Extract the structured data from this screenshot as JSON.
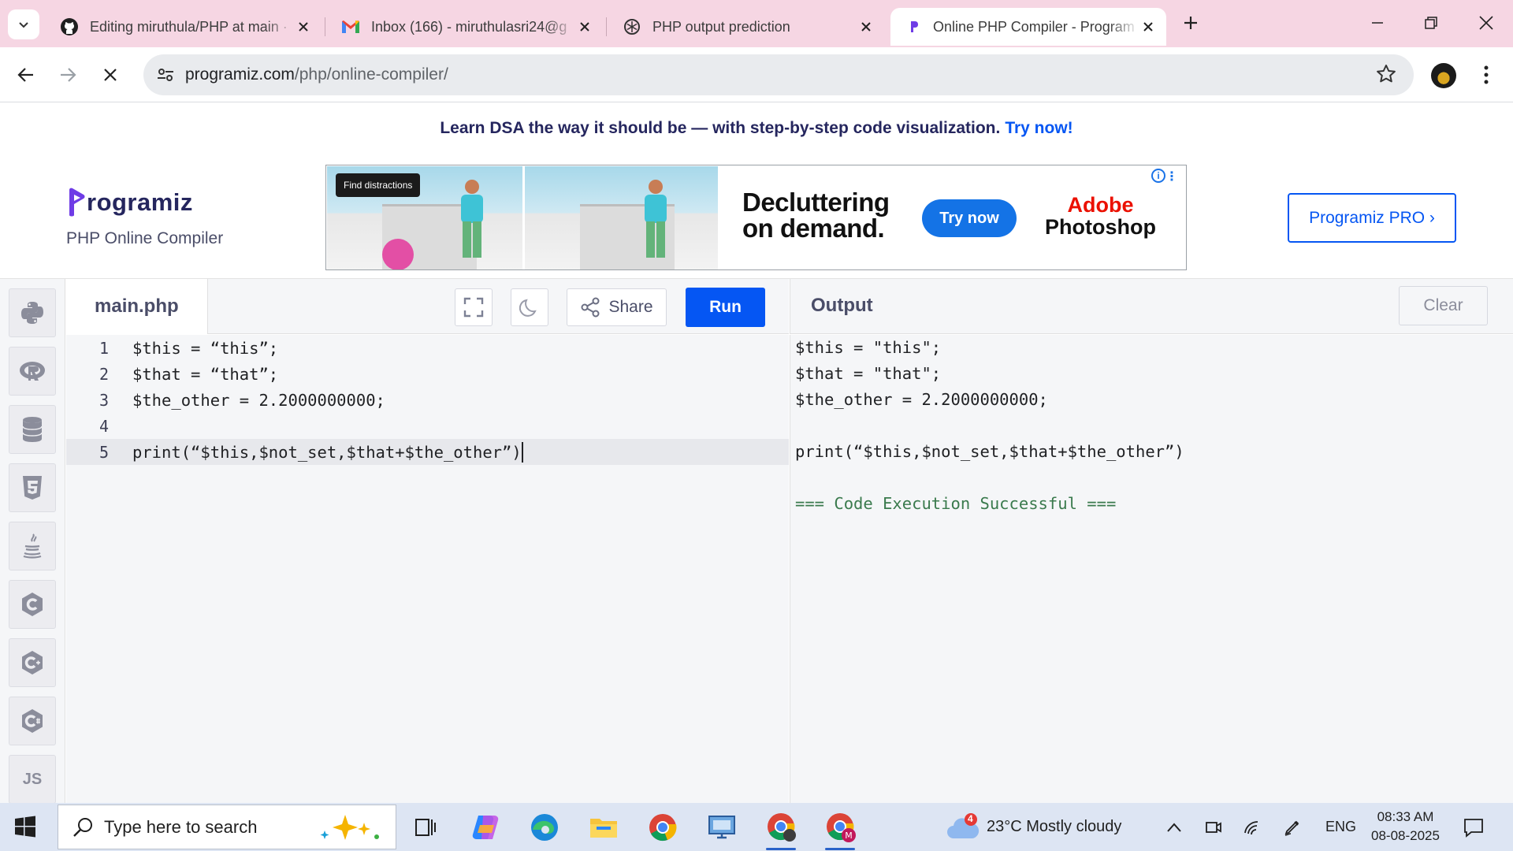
{
  "browser": {
    "tabs": [
      {
        "title": "Editing miruthula/PHP at main ·",
        "icon": "github-icon"
      },
      {
        "title": "Inbox (166) - miruthulasri24@g",
        "icon": "gmail-icon"
      },
      {
        "title": "PHP output prediction",
        "icon": "chatgpt-icon"
      },
      {
        "title": "Online PHP Compiler - Program",
        "icon": "programiz-icon",
        "active": true
      }
    ],
    "url_domain": "programiz.com",
    "url_path": "/php/online-compiler/"
  },
  "page": {
    "promo_text": "Learn DSA the way it should be — with step-by-step code visualization.",
    "promo_link": "Try now!",
    "logo_text": "rogramiz",
    "subtitle": "PHP Online Compiler",
    "pro_button": "Programiz PRO ›",
    "ad": {
      "tag": "Find distractions",
      "headline_1": "Decluttering",
      "headline_2": "on demand.",
      "cta": "Try now",
      "brand_1": "Adobe",
      "brand_2": "Photoshop"
    }
  },
  "rail": [
    {
      "name": "python-icon"
    },
    {
      "name": "r-icon"
    },
    {
      "name": "sql-icon"
    },
    {
      "name": "html-icon"
    },
    {
      "name": "java-icon"
    },
    {
      "name": "c-icon"
    },
    {
      "name": "cpp-icon"
    },
    {
      "name": "csharp-icon"
    },
    {
      "name": "js-icon",
      "label": "JS"
    }
  ],
  "editor": {
    "filename": "main.php",
    "share_label": "Share",
    "run_label": "Run",
    "lines": [
      {
        "num": "1",
        "code": "$this = “this”;"
      },
      {
        "num": "2",
        "code": "$that = “that”;"
      },
      {
        "num": "3",
        "code": "$the_other = 2.2000000000;"
      },
      {
        "num": "4",
        "code": ""
      },
      {
        "num": "5",
        "code": "print(“$this,$not_set,$that+$the_other”)"
      }
    ]
  },
  "output": {
    "title": "Output",
    "clear_label": "Clear",
    "lines": [
      "$this = \"this\";",
      "$that = \"that\";",
      "$the_other = 2.2000000000;",
      "",
      "print(“$this,$not_set,$that+$the_other”)",
      "",
      "=== Code Execution Successful ==="
    ]
  },
  "taskbar": {
    "search_placeholder": "Type here to search",
    "weather_badge": "4",
    "weather": "23°C  Mostly cloudy",
    "lang": "ENG",
    "time": "08:33 AM",
    "date": "08-08-2025"
  }
}
